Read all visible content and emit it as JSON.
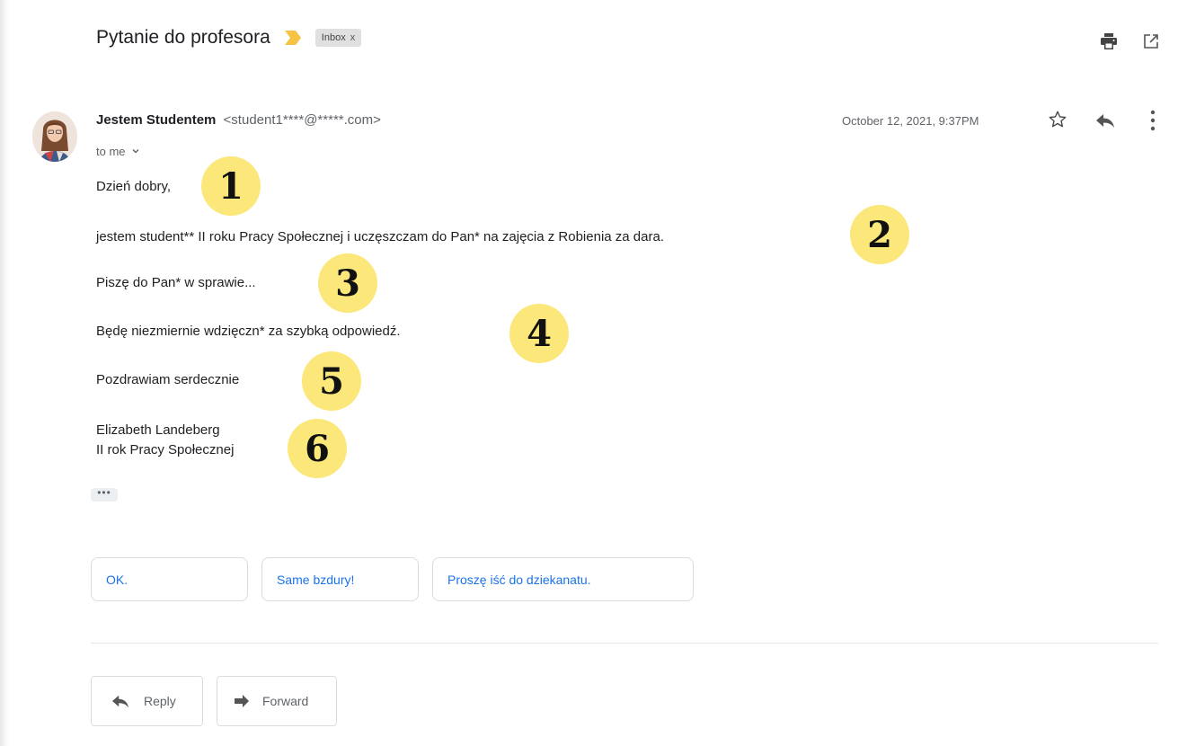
{
  "email": {
    "subject": "Pytanie do profesora",
    "label": "Inbox",
    "label_close": "x",
    "sender_name": "Jestem Studentem",
    "sender_email": "<student1****@*****.com>",
    "recipient": "to me",
    "date": "October 12, 2021, 9:37PM",
    "body": {
      "greeting": "Dzień dobry,",
      "intro": "jestem student** II roku Pracy Społecznej i uczęszczam do Pan* na zajęcia z Robienia za dara.",
      "purpose": "Piszę do Pan* w sprawie...",
      "thanks": "Będę niezmiernie wdzięczn* za szybką odpowiedź.",
      "closing": "Pozdrawiam serdecznie",
      "signature_name": "Elizabeth Landeberg",
      "signature_year": "II rok Pracy Społecznej"
    },
    "trimmed_content": "•••"
  },
  "badges": [
    "1",
    "2",
    "3",
    "4",
    "5",
    "6"
  ],
  "smart_replies": [
    "OK.",
    "Same bzdury!",
    "Proszę iść do dziekanatu."
  ],
  "actions": {
    "reply": "Reply",
    "forward": "Forward"
  },
  "icons": {
    "importance": "importance-marker-icon",
    "print": "print-icon",
    "new_window": "open-in-new-window-icon",
    "star": "star-icon",
    "reply": "reply-icon",
    "more": "more-vertical-icon",
    "expand": "chevron-down-icon",
    "forward": "forward-icon"
  },
  "colors": {
    "badge": "#fbe77a",
    "importance": "#f6c344",
    "link": "#1a73e8"
  }
}
